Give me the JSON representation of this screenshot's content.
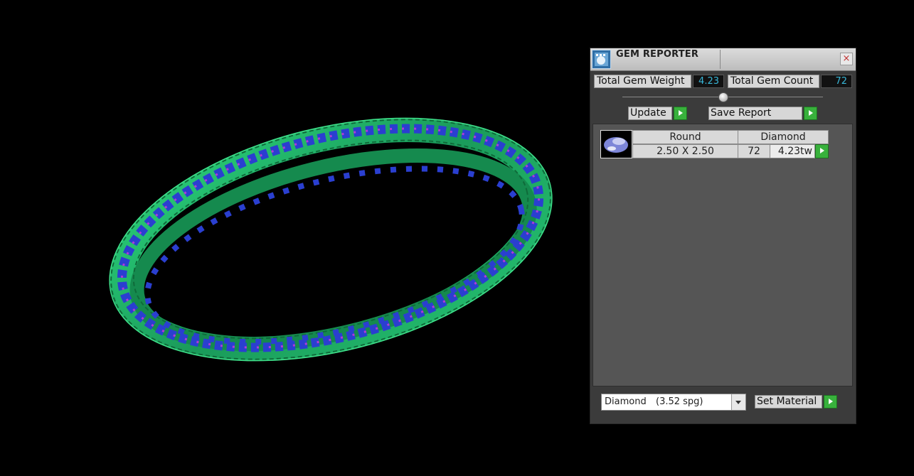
{
  "panel": {
    "title": "GEM REPORTER",
    "close_glyph": "×",
    "total_weight_label": "Total Gem Weight",
    "total_weight_value": "4.23",
    "total_count_label": "Total Gem Count",
    "total_count_value": "72",
    "update_label": "Update",
    "save_report_label": "Save Report",
    "gems": [
      {
        "shape": "Round",
        "material": "Diamond",
        "size": "2.50 X 2.50",
        "count": "72",
        "weight": "4.23tw"
      }
    ],
    "material_select": {
      "name": "Diamond",
      "spg": "(3.52 spg)"
    },
    "set_material_label": "Set Material"
  },
  "colors": {
    "accent_value": "#39b7d8",
    "play_button": "#38b13c",
    "ring_metal": "#1faa6a",
    "ring_gems": "#2a3fd0"
  },
  "icons": {
    "app": "gem-reporter-app-icon",
    "close": "close-icon",
    "play": "play-arrow-icon",
    "gem_thumbnail": "round-diamond-icon"
  }
}
